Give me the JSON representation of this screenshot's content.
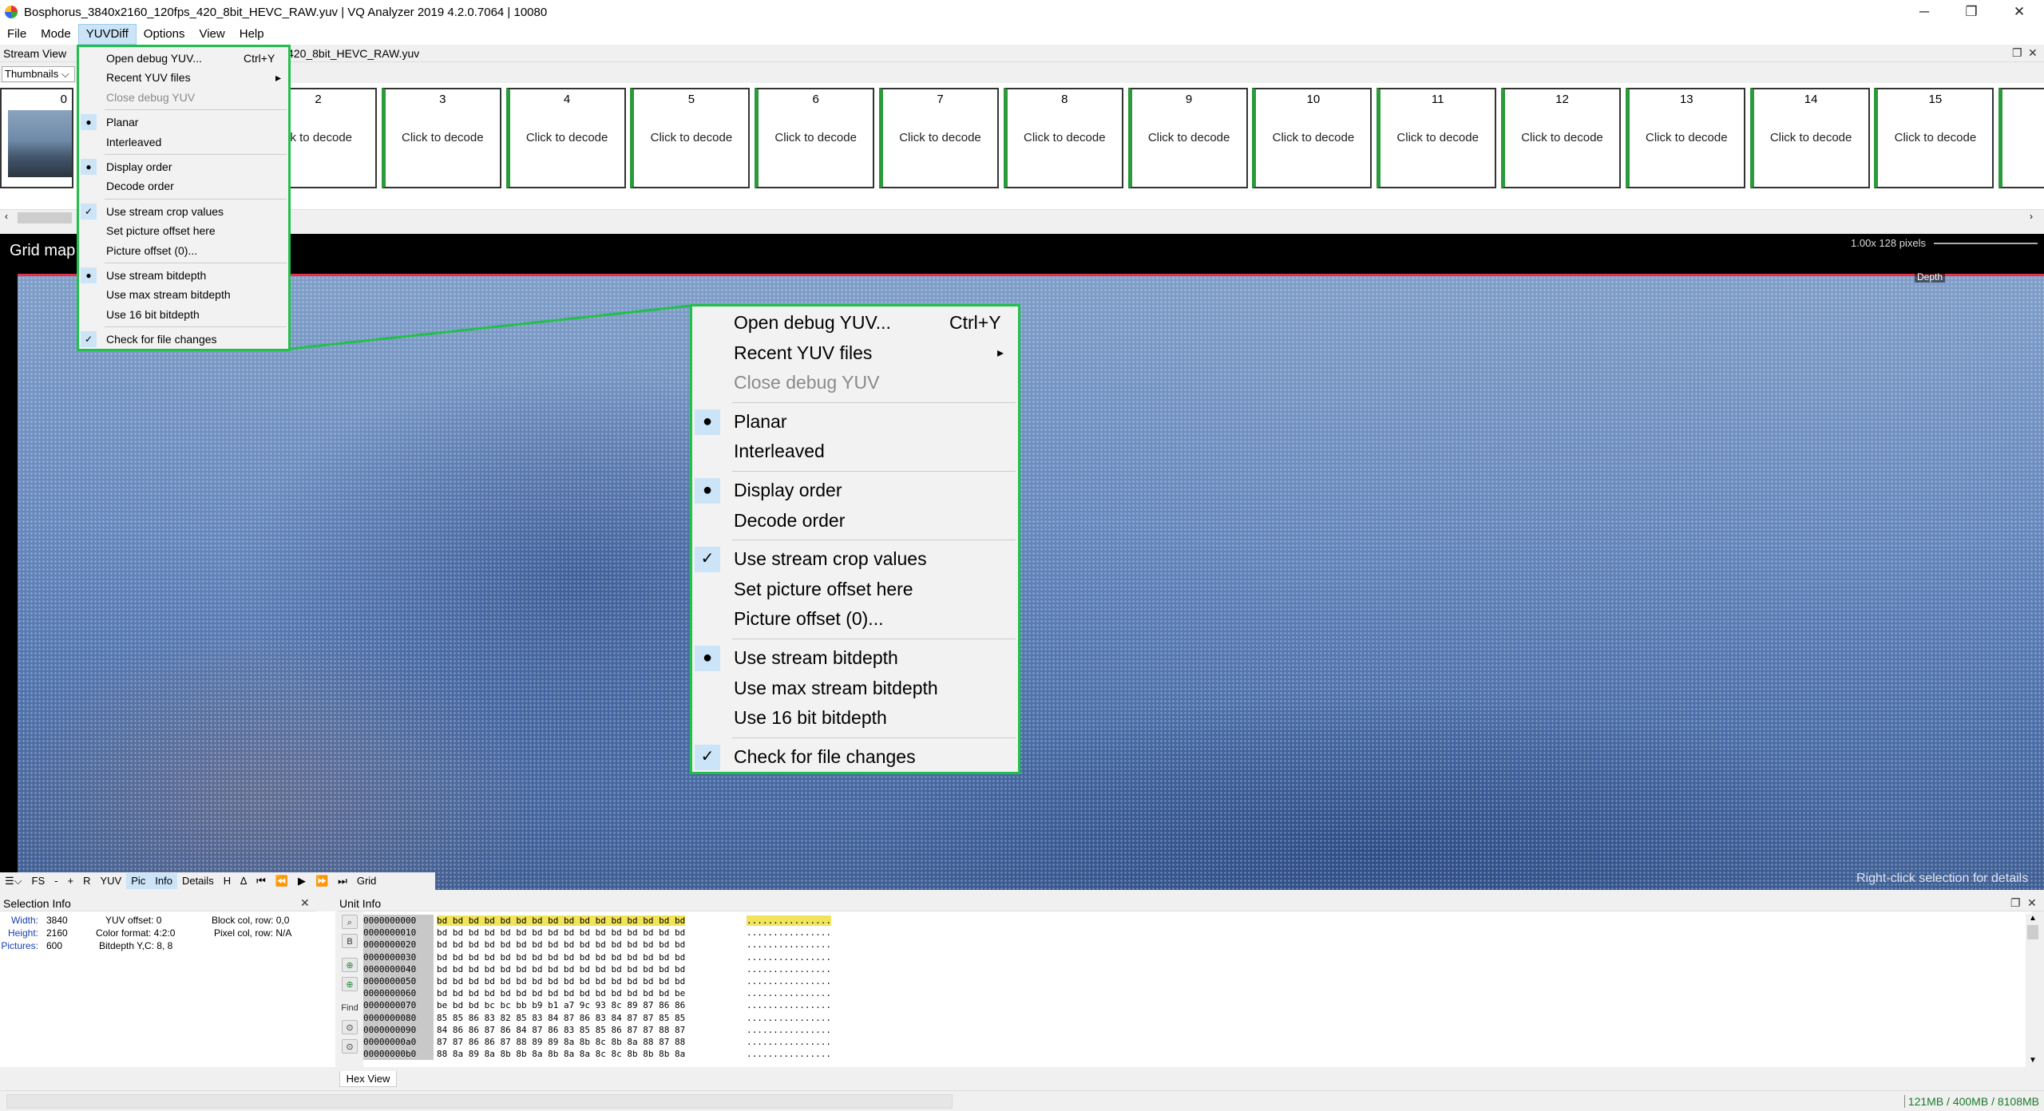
{
  "window": {
    "title": "Bosphorus_3840x2160_120fps_420_8bit_HEVC_RAW.yuv | VQ Analyzer 2019 4.2.0.7064  | 10080",
    "minimize": "─",
    "restore": "❐",
    "close": "✕"
  },
  "menubar": [
    "File",
    "Mode",
    "YUVDiff",
    "Options",
    "View",
    "Help"
  ],
  "stream_view": {
    "title": "Stream View",
    "file": "420_8bit_HEVC_RAW.yuv",
    "dropdown": "Thumbnails",
    "thumb0_num": "0",
    "thumbnails": [
      {
        "num": "2",
        "label": "ck to decode"
      },
      {
        "num": "3",
        "label": "Click to decode"
      },
      {
        "num": "4",
        "label": "Click to decode"
      },
      {
        "num": "5",
        "label": "Click to decode"
      },
      {
        "num": "6",
        "label": "Click to decode"
      },
      {
        "num": "7",
        "label": "Click to decode"
      },
      {
        "num": "8",
        "label": "Click to decode"
      },
      {
        "num": "9",
        "label": "Click to decode"
      },
      {
        "num": "10",
        "label": "Click to decode"
      },
      {
        "num": "11",
        "label": "Click to decode"
      },
      {
        "num": "12",
        "label": "Click to decode"
      },
      {
        "num": "13",
        "label": "Click to decode"
      },
      {
        "num": "14",
        "label": "Click to decode"
      },
      {
        "num": "15",
        "label": "Click to decode"
      },
      {
        "num": "",
        "label": "Click"
      }
    ]
  },
  "grid": {
    "label": "Grid map",
    "zoom": "1.00x  128 pixels",
    "depth": "Depth",
    "hint": "Right-click selection for details"
  },
  "toolbar": [
    "FS",
    "-",
    "+",
    "R",
    "YUV",
    "Pic",
    "Info",
    "Details",
    "H",
    "∆",
    "⏮",
    "⏪",
    "▶",
    "⏩",
    "⏭",
    "Grid"
  ],
  "yuvdiff_menu": {
    "items": [
      {
        "label": "Open debug YUV...",
        "shortcut": "Ctrl+Y",
        "mark": "",
        "disabled": false
      },
      {
        "label": "Recent YUV files",
        "shortcut": "",
        "mark": "",
        "disabled": false,
        "submenu": "▸"
      },
      {
        "label": "Close debug YUV",
        "shortcut": "",
        "mark": "",
        "disabled": true
      },
      {
        "sep": true
      },
      {
        "label": "Planar",
        "mark": "●"
      },
      {
        "label": "Interleaved",
        "mark": ""
      },
      {
        "sep": true
      },
      {
        "label": "Display order",
        "mark": "●"
      },
      {
        "label": "Decode order",
        "mark": ""
      },
      {
        "sep": true
      },
      {
        "label": "Use stream crop values",
        "mark": "✓"
      },
      {
        "label": "Set picture offset here",
        "mark": ""
      },
      {
        "label": "Picture offset (0)...",
        "mark": ""
      },
      {
        "sep": true
      },
      {
        "label": "Use stream bitdepth",
        "mark": "●"
      },
      {
        "label": "Use max stream bitdepth",
        "mark": ""
      },
      {
        "label": "Use 16 bit bitdepth",
        "mark": ""
      },
      {
        "sep": true
      },
      {
        "label": "Check for file changes",
        "mark": "✓"
      }
    ]
  },
  "selection_info": {
    "title": "Selection Info",
    "width_key": "Width:",
    "width": "3840",
    "height_key": "Height:",
    "height": "2160",
    "pictures_key": "Pictures:",
    "pictures": "600",
    "yuv_offset": "YUV offset:  0",
    "color_format": "Color format: 4:2:0",
    "bitdepth": "Bitdepth Y,C:  8, 8",
    "block": "Block col, row:  0,0",
    "pixel": "Pixel col, row:  N/A"
  },
  "unit_info": {
    "title": "Unit Info",
    "tab": "Hex View",
    "find": "Find",
    "b": "B",
    "offsets": [
      "0000000000",
      "0000000010",
      "0000000020",
      "0000000030",
      "0000000040",
      "0000000050",
      "0000000060",
      "0000000070",
      "0000000080",
      "0000000090",
      "00000000a0",
      "00000000b0"
    ],
    "bytes": [
      "bd bd bd bd bd bd bd bd bd bd bd bd bd bd bd bd",
      "bd bd bd bd bd bd bd bd bd bd bd bd bd bd bd bd",
      "bd bd bd bd bd bd bd bd bd bd bd bd bd bd bd bd",
      "bd bd bd bd bd bd bd bd bd bd bd bd bd bd bd bd",
      "bd bd bd bd bd bd bd bd bd bd bd bd bd bd bd bd",
      "bd bd bd bd bd bd bd bd bd bd bd bd bd bd bd bd",
      "bd bd bd bd bd bd bd bd bd bd bd bd bd bd bd be",
      "be bd bd bc bc bb b9 b1 a7 9c 93 8c 89 87 86 86",
      "85 85 86 83 82 85 83 84 87 86 83 84 87 87 85 85",
      "84 86 86 87 86 84 87 86 83 85 85 86 87 87 88 87",
      "87 87 86 86 87 88 89 89 8a 8b 8c 8b 8a 88 87 88",
      "88 8a 89 8a 8b 8b 8a 8b 8a 8a 8c 8c 8b 8b 8b 8a"
    ],
    "ascii": "................"
  },
  "status": {
    "memory": "121MB / 400MB / 8108MB"
  },
  "colors": {
    "highlight_border": "#22c04a",
    "thumb_accent": "#2a9a3a",
    "grid_top_line": "#e8304a"
  }
}
